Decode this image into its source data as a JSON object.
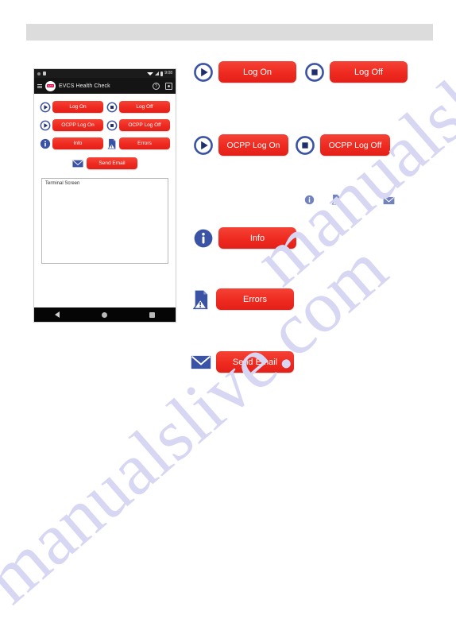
{
  "page": {
    "watermark_text": "manualslive.com",
    "watermark_color": "#d7d7f4",
    "background_color": "#ffffff",
    "top_bar_color": "#dcdcdc"
  },
  "colors": {
    "button_red": "#ef2a20",
    "icon_blue": "#3b53a4",
    "app_bar_black": "#141414",
    "logo_red": "#d6003c"
  },
  "phone": {
    "status_bar": {
      "time": "9:08",
      "icons": [
        "circle-indicator",
        "lock-icon",
        "wifi-icon",
        "signal-icon",
        "battery-icon"
      ]
    },
    "app_bar": {
      "menu_icon": "hamburger-icon",
      "logo": "EVCS",
      "title": "EVCS Health Check",
      "actions": [
        "help-icon",
        "qr-scan-icon"
      ]
    },
    "buttons": [
      {
        "label": "Log On",
        "icon": "play-circle-icon"
      },
      {
        "label": "Log Off",
        "icon": "stop-circle-icon"
      },
      {
        "label": "OCPP Log On",
        "icon": "play-circle-icon"
      },
      {
        "label": "OCPP Log Off",
        "icon": "stop-circle-icon"
      },
      {
        "label": "Info",
        "icon": "info-circle-icon"
      },
      {
        "label": "Errors",
        "icon": "error-document-icon"
      },
      {
        "label": "Send Email",
        "icon": "envelope-icon"
      }
    ],
    "terminal": {
      "label": "Terminal Screen",
      "content": ""
    },
    "nav_bar": {
      "back": "back-triangle-icon",
      "home": "home-circle-icon",
      "recents": "recents-square-icon"
    }
  },
  "callouts": {
    "rows": [
      {
        "id": "logon",
        "items": [
          {
            "label": "Log On",
            "icon": "play-circle-icon"
          },
          {
            "label": "Log Off",
            "icon": "stop-circle-icon"
          }
        ]
      },
      {
        "id": "ocpp",
        "items": [
          {
            "label": "OCPP Log On",
            "icon": "play-circle-icon"
          },
          {
            "label": "OCPP Log Off",
            "icon": "stop-circle-icon"
          }
        ]
      },
      {
        "id": "info",
        "items": [
          {
            "label": "Info",
            "icon": "info-circle-icon"
          }
        ]
      },
      {
        "id": "errors",
        "items": [
          {
            "label": "Errors",
            "icon": "error-document-icon"
          }
        ]
      },
      {
        "id": "email",
        "items": [
          {
            "label": "Send Email",
            "icon": "envelope-icon"
          }
        ]
      }
    ],
    "tiny_icons": [
      "info-circle-icon",
      "error-document-icon",
      "envelope-icon"
    ]
  }
}
